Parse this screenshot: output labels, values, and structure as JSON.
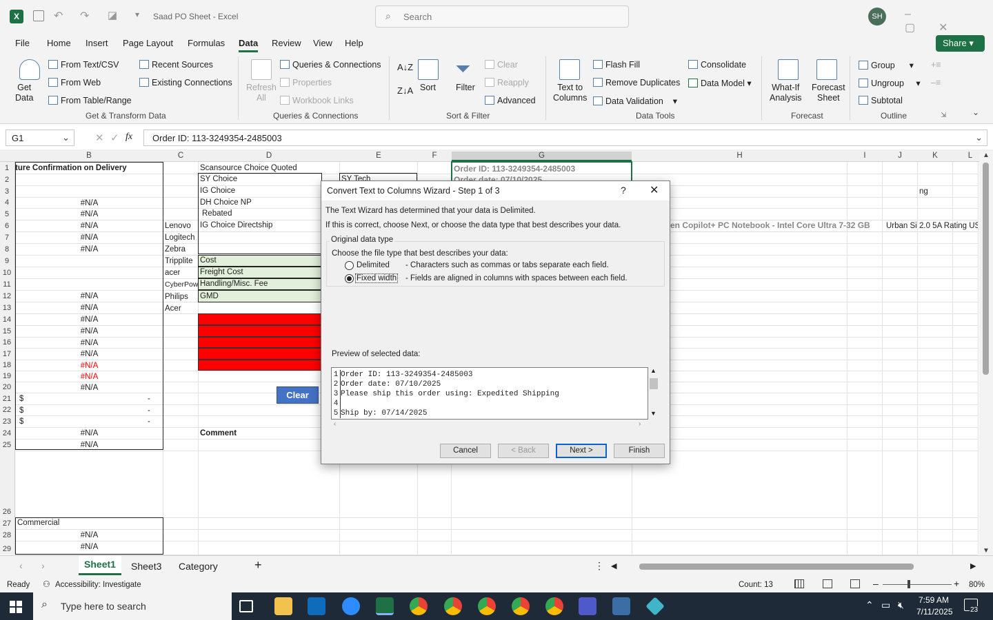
{
  "title": {
    "text": "Saad PO Sheet  -  Excel",
    "search": "Search",
    "avatar": "SH"
  },
  "menu": [
    "File",
    "Home",
    "Insert",
    "Page Layout",
    "Formulas",
    "Data",
    "Review",
    "View",
    "Help"
  ],
  "share": "Share",
  "ribbon": {
    "get_data": "Get\nData",
    "from_text": "From Text/CSV",
    "from_web": "From Web",
    "from_table": "From Table/Range",
    "recent": "Recent Sources",
    "existing": "Existing Connections",
    "refresh": "Refresh\nAll",
    "queries": "Queries & Connections",
    "properties": "Properties",
    "workbook_links": "Workbook Links",
    "sort": "Sort",
    "filter": "Filter",
    "clear": "Clear",
    "reapply": "Reapply",
    "advanced": "Advanced",
    "text_to_columns": "Text to\nColumns",
    "flash_fill": "Flash Fill",
    "remove_dup": "Remove Duplicates",
    "data_validation": "Data Validation",
    "consolidate": "Consolidate",
    "data_model": "Data Model",
    "what_if": "What-If\nAnalysis",
    "forecast_sheet": "Forecast\nSheet",
    "group": "Group",
    "ungroup": "Ungroup",
    "subtotal": "Subtotal",
    "groups": [
      "Get & Transform Data",
      "Queries & Connections",
      "Sort & Filter",
      "Data Tools",
      "Forecast",
      "Outline"
    ]
  },
  "formula_bar": {
    "name_box": "G1",
    "fx": "fx",
    "formula": "Order ID: 113-3249354-2485003"
  },
  "columns": [
    "B",
    "C",
    "D",
    "E",
    "F",
    "G",
    "H",
    "I",
    "J",
    "K",
    "L"
  ],
  "rows": [
    "1",
    "2",
    "3",
    "4",
    "5",
    "6",
    "7",
    "8",
    "9",
    "10",
    "11",
    "12",
    "13",
    "14",
    "15",
    "16",
    "17",
    "18",
    "19",
    "20",
    "21",
    "22",
    "23",
    "24",
    "25",
    "26",
    "27",
    "28",
    "29"
  ],
  "cells": {
    "b1": "ture Confirmation on Delivery",
    "na": "#N/A",
    "dollar": "$",
    "dash": "-",
    "b27": "Commercial",
    "c": [
      "Lenovo",
      "Logitech",
      "Zebra",
      "Tripplite",
      "acer",
      "CyberPow",
      "Philips",
      "Acer"
    ],
    "d": [
      "Scansource Choice Quoted",
      "SY Choice",
      "IG Choice",
      "DH Choice NP",
      "Rebated",
      "IG Choice Directship"
    ],
    "d_cost": [
      "Cost",
      "Freight Cost",
      "Handling/Misc. Fee",
      "GMD"
    ],
    "e2": "SY Tech",
    "clear_btn": "Clear",
    "comment": "Comment",
    "g1": "Order ID: 113-3249354-2485003",
    "g2": "Order date: 07/10/2025",
    "h6": "en Copilot+ PC Notebook - Intel Core Ultra 7-32 GB",
    "j6": "Urban Si",
    "k6": "2.0 5A Rating US",
    "k3": "ng"
  },
  "dialog": {
    "title": "Convert Text to Columns Wizard - Step 1 of 3",
    "help": "?",
    "line1": "The Text Wizard has determined that your data is Delimited.",
    "line2": "If this is correct, choose Next, or choose the data type that best describes your data.",
    "group_label": "Original data type",
    "choose": "Choose the file type that best describes your data:",
    "delimited": "Delimited",
    "delimited_desc": "- Characters such as commas or tabs separate each field.",
    "fixed": "Fixed width",
    "fixed_desc": "- Fields are aligned in columns with spaces between each field.",
    "preview_label": "Preview of selected data:",
    "preview": [
      {
        "n": "1",
        "t": "Order ID: 113-3249354-2485003"
      },
      {
        "n": "2",
        "t": "Order date: 07/10/2025"
      },
      {
        "n": "3",
        "t": "Please ship this order using: Expedited Shipping"
      },
      {
        "n": "4",
        "t": ""
      },
      {
        "n": "5",
        "t": "Ship by: 07/14/2025"
      }
    ],
    "cancel": "Cancel",
    "back": "< Back",
    "next": "Next >",
    "finish": "Finish",
    "selected": "Fixed width"
  },
  "sheets": [
    "Sheet1",
    "Sheet3",
    "Category"
  ],
  "status": {
    "ready": "Ready",
    "accessibility": "Accessibility: Investigate",
    "count": "Count: 13",
    "zoom": "80%"
  },
  "taskbar": {
    "search": "Type here to search",
    "time": "7:59 AM",
    "date": "7/11/2025",
    "notif": "23"
  },
  "colors": {
    "excel_green": "#1e7145",
    "accent": "#0a64c8",
    "red_cell": "#ff0000",
    "clear_btn": "#4472c4"
  }
}
